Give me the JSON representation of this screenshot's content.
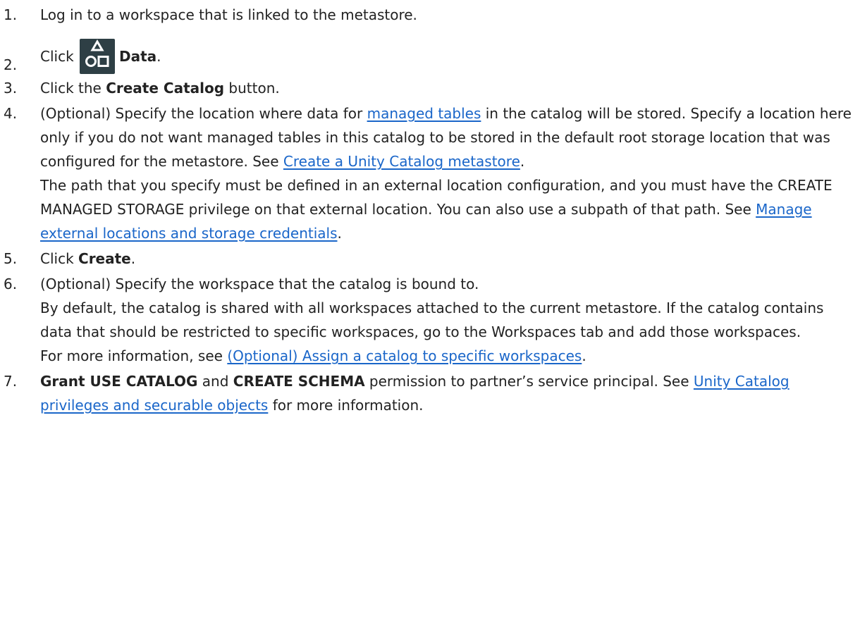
{
  "steps": [
    {
      "num": "1.",
      "text": "Log in to a workspace that is linked to the metastore."
    },
    {
      "num": "2.",
      "pre": "Click ",
      "icon": "data-catalog-icon",
      "bold": "Data",
      "post": "."
    },
    {
      "num": "3.",
      "pre": "Click the ",
      "bold": "Create Catalog",
      "post": " button."
    },
    {
      "num": "4.",
      "p1_pre": "(Optional) Specify the location where data for ",
      "p1_link": "managed tables",
      "p1_mid": " in the catalog will be stored. Specify a location here only if you do not want managed tables in this catalog to be stored in the default root storage location that was configured for the metastore. See ",
      "p1_link2": "Create a Unity Catalog metastore",
      "p1_post": ".",
      "p2_pre": "The path that you specify must be defined in an external location configuration, and you must have the CREATE MANAGED STORAGE privilege on that external location. You can also use a subpath of that path. See ",
      "p2_link": "Manage external locations and storage credentials",
      "p2_post": "."
    },
    {
      "num": "5.",
      "pre": "Click ",
      "bold": "Create",
      "post": "."
    },
    {
      "num": "6.",
      "p1": "(Optional) Specify the workspace that the catalog is bound to.",
      "p2": "By default, the catalog is shared with all workspaces attached to the current metastore. If the catalog contains data that should be restricted to specific workspaces, go to the Workspaces tab and add those workspaces.",
      "p3_pre": "For more information, see ",
      "p3_link": "(Optional) Assign a catalog to specific workspaces",
      "p3_post": "."
    },
    {
      "num": "7.",
      "bold1": "Grant USE CATALOG",
      "mid": " and ",
      "bold2": "CREATE SCHEMA",
      "post": " permission to partner’s  service principal. See ",
      "link": "Unity Catalog privileges and securable objects",
      "tail": " for more information."
    }
  ],
  "colors": {
    "text": "#222222",
    "link": "#1a66c9",
    "icon_bg": "#2e3f45"
  }
}
